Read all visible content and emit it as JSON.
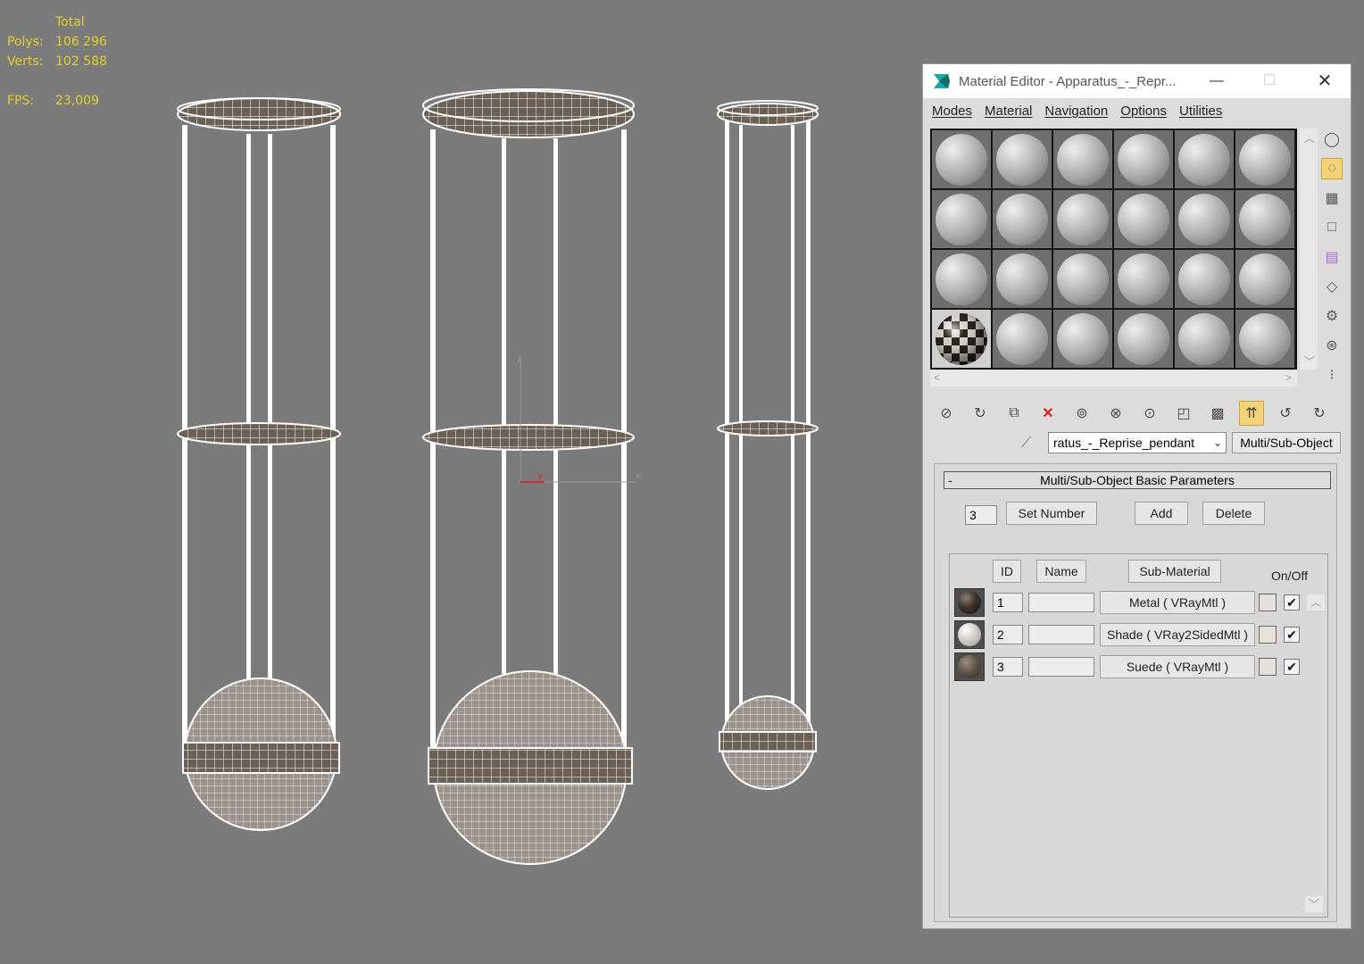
{
  "viewport": {
    "stats": {
      "header": "Total",
      "polys_label": "Polys:",
      "polys_value": "106 296",
      "verts_label": "Verts:",
      "verts_value": "102 588",
      "fps_label": "FPS:",
      "fps_value": "23,009"
    },
    "axis": {
      "z": "z",
      "y": "y",
      "x": "x"
    }
  },
  "material_editor": {
    "title": "Material Editor - Apparatus_-_Repr...",
    "menu": [
      "Modes",
      "Material",
      "Navigation",
      "Options",
      "Utilities"
    ],
    "material_name": "ratus_-_Reprise_pendant",
    "material_type": "Multi/Sub-Object",
    "rollout_title": "Multi/Sub-Object Basic Parameters",
    "rollout_toggle": "-",
    "count_value": "3",
    "set_number_label": "Set Number",
    "add_label": "Add",
    "delete_label": "Delete",
    "col_id": "ID",
    "col_name": "Name",
    "col_submaterial": "Sub-Material",
    "col_onoff": "On/Off",
    "rows": [
      {
        "id": "1",
        "name": "",
        "sub": "Metal  ( VRayMtl )",
        "on": "✔"
      },
      {
        "id": "2",
        "name": "",
        "sub": "Shade  ( VRay2SidedMtl )",
        "on": "✔"
      },
      {
        "id": "3",
        "name": "",
        "sub": "Suede  ( VRayMtl )",
        "on": "✔"
      }
    ],
    "active_slot": 18
  },
  "colors": {
    "stats_text": "#e6cf2a",
    "viewport_bg": "#7b7b7b",
    "accent_tool": "#f3d27a",
    "delete_red": "#d41e1e"
  }
}
